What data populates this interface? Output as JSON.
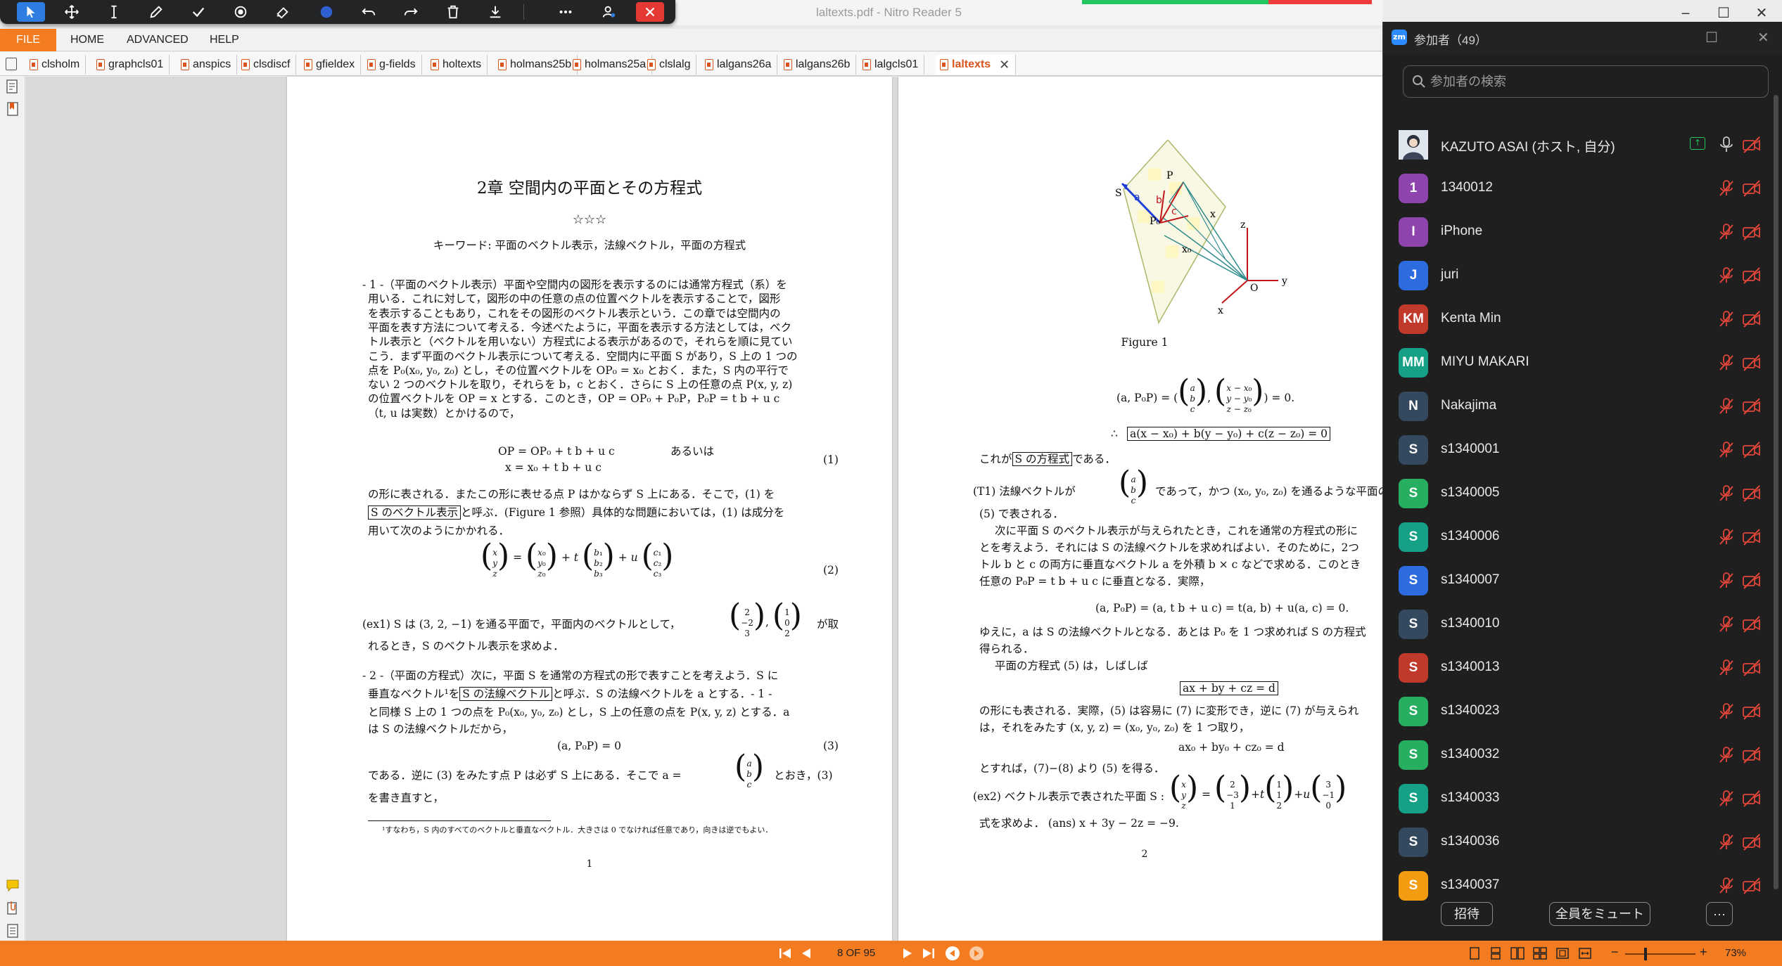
{
  "window": {
    "title": "laltexts.pdf - Nitro Reader 5"
  },
  "menu": {
    "file": "FILE",
    "home": "HOME",
    "advanced": "ADVANCED",
    "help": "HELP"
  },
  "tabs": [
    "clsholm",
    "graphcls01",
    "anspics",
    "clsdiscf",
    "gfieldex",
    "g-fields",
    "holtexts",
    "holmans25b",
    "holmans25a",
    "clslalg",
    "lalgans26a",
    "lalgans26b",
    "lalgcls01",
    "laltexts"
  ],
  "status": {
    "page": "8 OF 95",
    "zoom": "73%"
  },
  "page1": {
    "chapter": "2章 空間内の平面とその方程式",
    "stars": "☆☆☆",
    "keywords": "キーワード: 平面のベクトル表示，法線ベクトル，平面の方程式",
    "p1": [
      "- 1 -（平面のベクトル表示）平面や空間内の図形を表示するのには通常方程式（系）を",
      "用いる．これに対して，図形の中の任意の点の位置ベクトルを表示することで，図形",
      "を表示することもあり，これをその図形のベクトル表示という．この章では空間内の",
      "平面を表す方法について考える．今述べたように，平面を表示する方法としては，ベク",
      "トル表示と（ベクトルを用いない）方程式による表示があるので，それらを順に見てい",
      "こう．まず平面のベクトル表示について考える．空間内に平面 S があり，S 上の 1 つの",
      "点を P₀(x₀, y₀, z₀) とし，その位置ベクトルを OP₀ = x₀ とおく．また，S 内の平行で",
      "ない 2 つのベクトルを取り，それらを b，c とおく．さらに S 上の任意の点 P(x, y, z)",
      "の位置ベクトルを OP = x とする．このとき，OP = OP₀ + P₀P，P₀P = t b + u c",
      "（t, u は実数）とかけるので，"
    ],
    "eq1a": "OP  = OP₀ + t b + u c",
    "eq1b": "x   = x₀ + t b + u c",
    "eq1or": "あるいは",
    "eq1num": "(1)",
    "p2a": "の形に表される．またこの形に表せる点 P はかならず S 上にある．そこで，(1) を",
    "p2box": "S のベクトル表示",
    "p2b": "と呼ぶ．(Figure 1 参照）具体的な問題においては，(1) は成分を",
    "p2c": "用いて次のようにかかれる．",
    "eq2num": "(2)",
    "ex1a": "(ex1) S は (3, 2, −1) を通る平面で，平面内のベクトルとして，",
    "ex1b": "が取",
    "ex1c": "れるとき，S のベクトル表示を求めよ．",
    "p3a": "- 2 -（平面の方程式）次に，平面 S を通常の方程式の形で表すことを考えよう．S に",
    "p3b1": "垂直なベクトル¹を",
    "p3box": "S の法線ベクトル",
    "p3b2": "と呼ぶ．S の法線ベクトルを a とする．- 1 -",
    "p3c": "と同様 S 上の 1 つの点を P₀(x₀, y₀, z₀) とし，S 上の任意の点を P(x, y, z) とする．a",
    "p3d": "は S の法線ベクトルだから，",
    "eq3": "(a, P₀P) = 0",
    "eq3num": "(3)",
    "p4a": "である．逆に (3) をみたす点 P は必ず S 上にある．そこで a =",
    "p4b": "とおき，(3)",
    "p4c": "を書き直すと，",
    "footnote": "¹すなわち，S 内のすべてのベクトルと垂直なベクトル．大きさは 0 でなければ任意であり，向きは逆でもよい．",
    "pagenum": "1"
  },
  "page2": {
    "figure_caption": "Figure 1",
    "fig_labels": {
      "S": "S",
      "P": "P",
      "P0": "P₀",
      "X": "x",
      "X0": "x₀",
      "a": "a",
      "b": "b",
      "c": "c",
      "z": "z",
      "y": "y",
      "xaxis": "x",
      "O": "O"
    },
    "eq_top": "(a, P₀P) = (  ,  ) = 0.",
    "therefore": "∴",
    "eq_box": "a(x − x₀) + b(y − y₀) + c(z − z₀) = 0",
    "l1a": "これが",
    "l1box": "S の方程式",
    "l1b": "である．",
    "t1a": "(T1) 法線ベクトルが",
    "t1b": "であって，かつ (x₀, y₀, z₀) を通るような平面の方",
    "t1c": "(5) で表される．",
    "l2": "次に平面 S のベクトル表示が与えられたとき，これを通常の方程式の形に",
    "l3": "とを考えよう．それには S の法線ベクトルを求めればよい．そのために，2つ",
    "l4": "トル b と c の両方に垂直なベクトル a を外積 b × c などで求める．このとき",
    "l5": "任意の P₀P = t b + u c に垂直となる．実際，",
    "eq_mid": "(a, P₀P) = (a, t b + u c) = t(a, b) + u(a, c) = 0.",
    "l6": "ゆえに，a は S の法線ベクトルとなる．あとは P₀ を 1 つ求めれば S の方程式",
    "l7": "得られる．",
    "l8": "平面の方程式 (5) は，しばしば",
    "eq_box2": "ax + by + cz = d",
    "l9": "の形にも表される．実際，(5) は容易に (7) に変形でき，逆に (7) が与えられ",
    "l10": "は，それをみたす (x, y, z) = (x₀, y₀, z₀) を 1 つ取り，",
    "eq_d": "ax₀ + by₀ + cz₀ = d",
    "l11": "とすれば，(7)−(8) より (5) を得る．",
    "ex2a": "(ex2) ベクトル表示で表された平面 S :",
    "ex2b": "式を求めよ．  (ans) x + 3y − 2z = −9.",
    "pagenum": "2"
  },
  "zoom": {
    "title": "参加者（49）",
    "search_placeholder": "参加者の検索",
    "participants": [
      {
        "initials": "",
        "name": "KAZUTO ASAI (ホスト, 自分)",
        "color": "#dfe6ee"
      },
      {
        "initials": "1",
        "name": "1340012",
        "color": "#8e44ad"
      },
      {
        "initials": "I",
        "name": "iPhone",
        "color": "#8e44ad"
      },
      {
        "initials": "J",
        "name": "juri",
        "color": "#2d6cdf"
      },
      {
        "initials": "KM",
        "name": "Kenta Min",
        "color": "#c0392b"
      },
      {
        "initials": "MM",
        "name": "MIYU MAKARI",
        "color": "#16a085"
      },
      {
        "initials": "N",
        "name": "Nakajima",
        "color": "#34495e"
      },
      {
        "initials": "S",
        "name": "s1340001",
        "color": "#34495e"
      },
      {
        "initials": "S",
        "name": "s1340005",
        "color": "#27ae60"
      },
      {
        "initials": "S",
        "name": "s1340006",
        "color": "#16a085"
      },
      {
        "initials": "S",
        "name": "s1340007",
        "color": "#2d6cdf"
      },
      {
        "initials": "S",
        "name": "s1340010",
        "color": "#34495e"
      },
      {
        "initials": "S",
        "name": "s1340013",
        "color": "#c0392b"
      },
      {
        "initials": "S",
        "name": "s1340023",
        "color": "#27ae60"
      },
      {
        "initials": "S",
        "name": "s1340032",
        "color": "#27ae60"
      },
      {
        "initials": "S",
        "name": "s1340033",
        "color": "#16a085"
      },
      {
        "initials": "S",
        "name": "s1340036",
        "color": "#34495e"
      },
      {
        "initials": "S",
        "name": "s1340037",
        "color": "#f39c12"
      }
    ],
    "invite": "招待",
    "mute_all": "全員をミュート",
    "more": "···"
  }
}
